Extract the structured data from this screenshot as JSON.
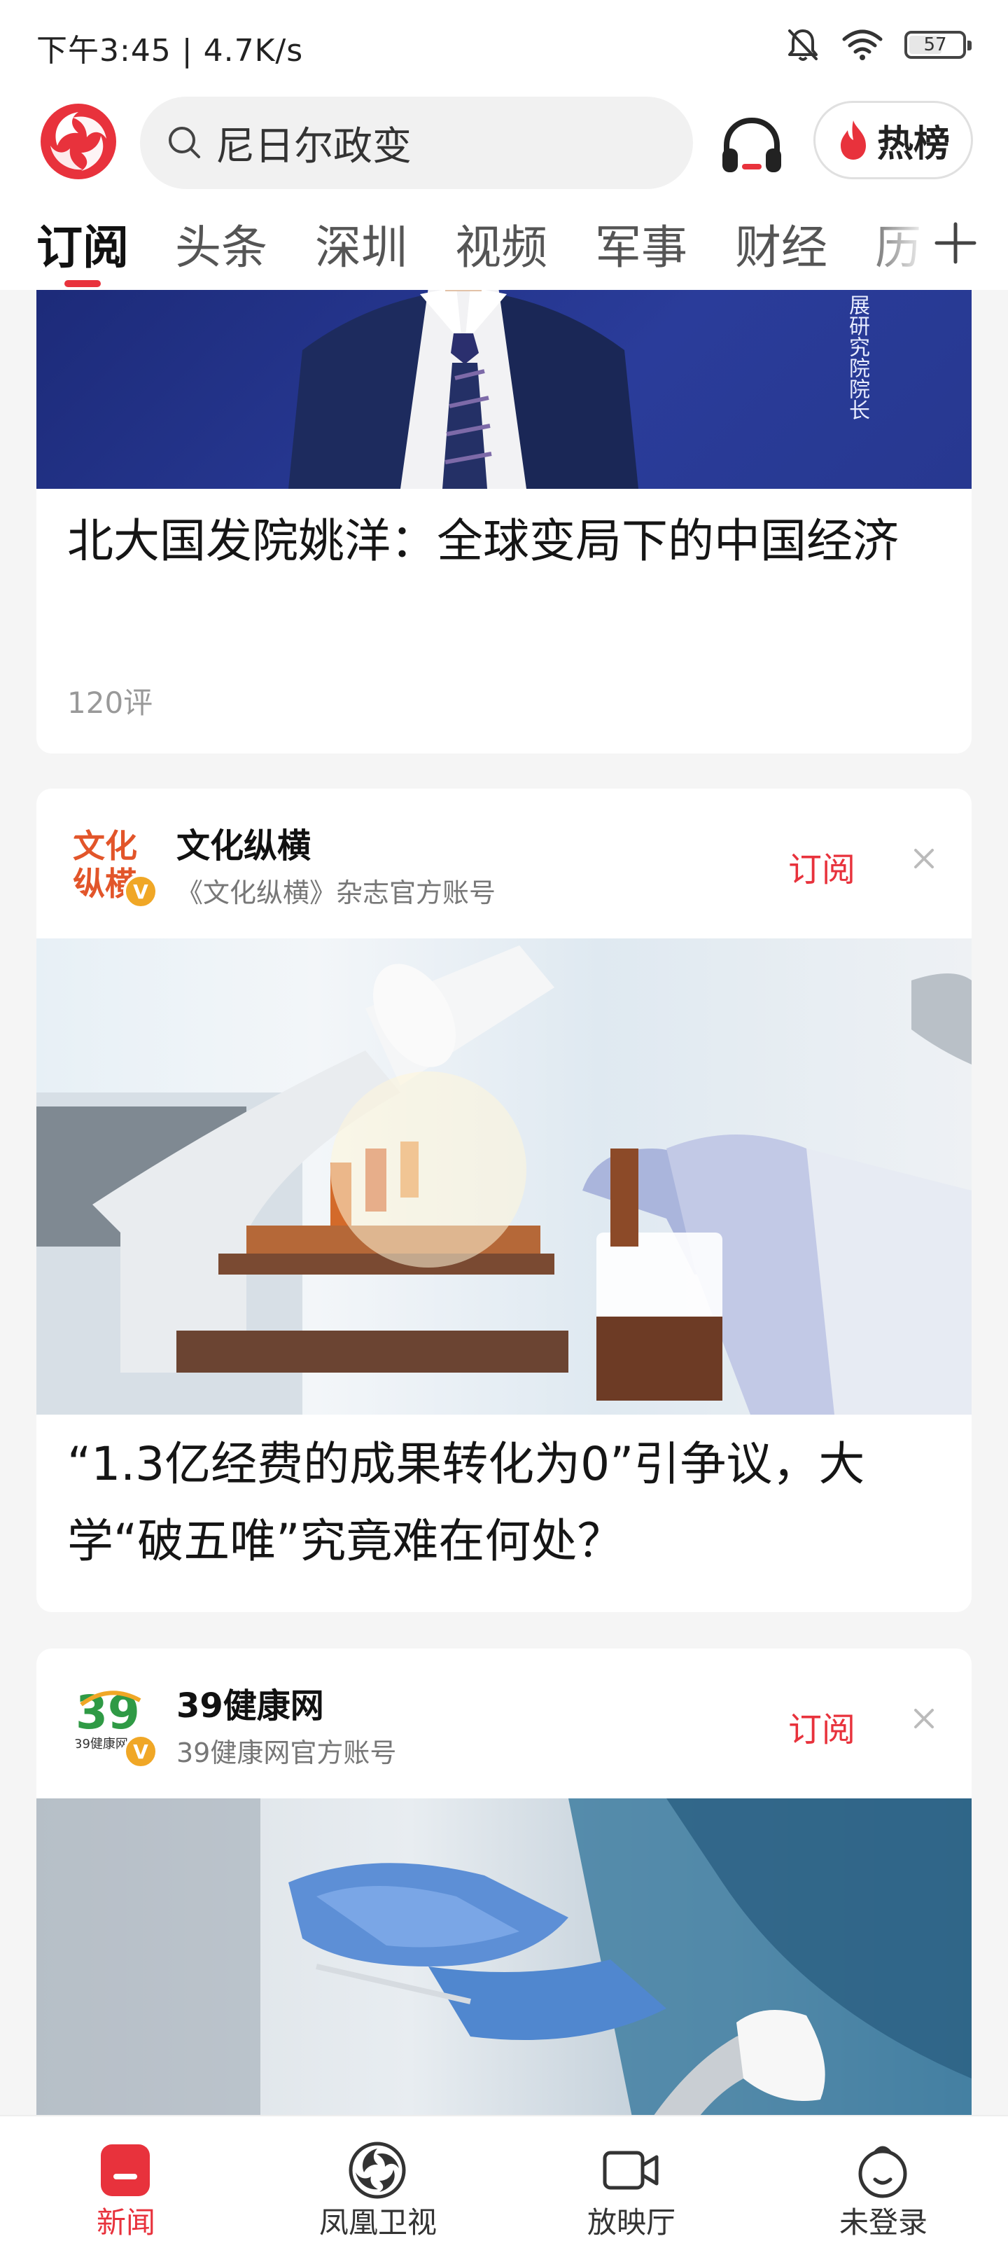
{
  "status_bar": {
    "time_speed": "下午3:45 | 4.7K/s",
    "battery": "57"
  },
  "header": {
    "search_placeholder": "尼日尔政变",
    "hot_button": "热榜"
  },
  "tabs": [
    "订阅",
    "头条",
    "深圳",
    "视频",
    "军事",
    "财经",
    "历"
  ],
  "cards": [
    {
      "hero_overlay": "展研究院院长",
      "title": "北大国发院姚洋：全球变局下的中国经济",
      "comments": "120评"
    },
    {
      "account_name": "文化纵横",
      "account_desc": "《文化纵横》杂志官方账号",
      "avatar_text": "文化纵横",
      "subscribe": "订阅",
      "title": "“1.3亿经费的成果转化为0”引争议，大学“破五唯”究竟难在何处？"
    },
    {
      "account_name": "39健康网",
      "account_desc": "39健康网官方账号",
      "avatar_text": "39健康网",
      "subscribe": "订阅"
    }
  ],
  "bottom_nav": [
    "新闻",
    "凤凰卫视",
    "放映厅",
    "未登录"
  ],
  "colors": {
    "accent": "#e8323c",
    "badge": "#f0a726"
  }
}
